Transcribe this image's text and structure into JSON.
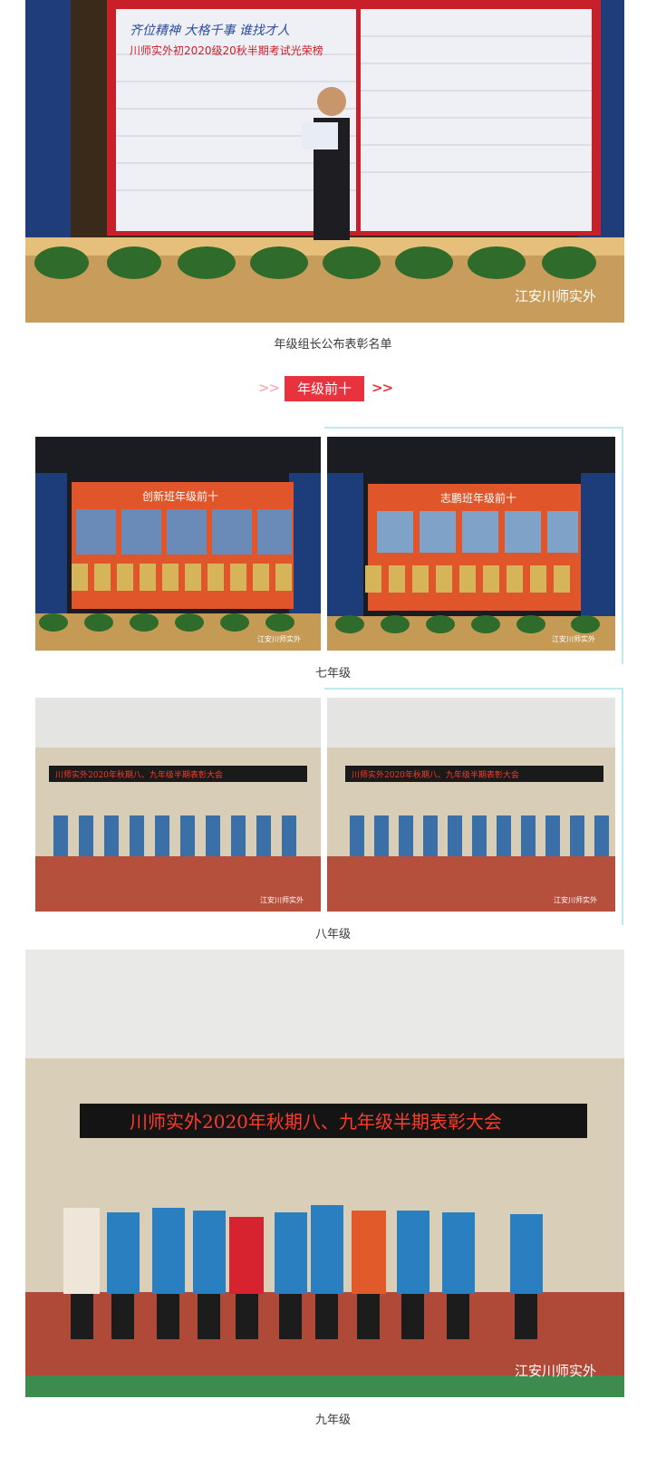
{
  "watermark": "江安川师实外",
  "captions": {
    "top_photo": "年级组长公布表彰名单",
    "grade7": "七年级",
    "grade8": "八年级",
    "grade9": "九年级"
  },
  "section": {
    "tag": "年级前十",
    "left_arrows": ">>",
    "right_arrows": ">>"
  },
  "photos": {
    "stage": {
      "screen_text_left": "齐位精神  大格千事 谁找才人",
      "screen_title": "川师实外初2020级20秋半期考试光荣榜"
    },
    "grade7_left": {
      "screen_title": "创新班年级前十"
    },
    "grade7_right": {
      "screen_title": "志鹏班年级前十"
    },
    "banner": "川师实外2020年秋期八、九年级半期表彰大会"
  },
  "colors": {
    "accent_red": "#e8323e",
    "arrow_light": "#f5b2ba",
    "frame_line": "#bfe9ef"
  }
}
